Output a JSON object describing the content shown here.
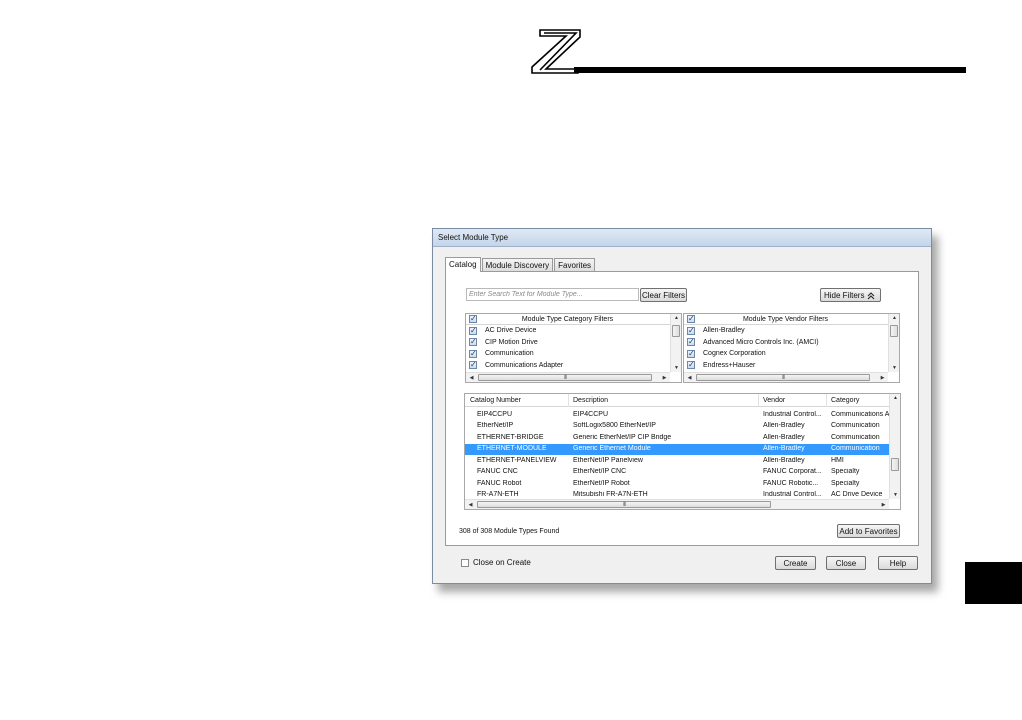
{
  "dialog": {
    "title": "Select Module Type",
    "tabs": [
      "Catalog",
      "Module Discovery",
      "Favorites"
    ],
    "search_placeholder": "Enter Search Text for Module Type...",
    "clear_filters_label": "Clear Filters",
    "hide_filters_label": "Hide Filters",
    "category_filter": {
      "header": "Module Type Category Filters",
      "items": [
        {
          "label": "AC Drive Device",
          "checked": true
        },
        {
          "label": "CIP Motion Drive",
          "checked": true
        },
        {
          "label": "Communication",
          "checked": true
        },
        {
          "label": "Communications Adapter",
          "checked": true
        }
      ]
    },
    "vendor_filter": {
      "header": "Module Type Vendor Filters",
      "items": [
        {
          "label": "Allen-Bradley",
          "checked": true
        },
        {
          "label": "Advanced Micro Controls Inc. (AMCI)",
          "checked": true
        },
        {
          "label": "Cognex Corporation",
          "checked": true
        },
        {
          "label": "Endress+Hauser",
          "checked": true
        }
      ]
    },
    "table": {
      "columns": [
        "Catalog Number",
        "Description",
        "Vendor",
        "Category"
      ],
      "rows": [
        {
          "catalog": "EIP4CCPU",
          "description": "EIP4CCPU",
          "vendor": "Industrial Control...",
          "category": "Communications A",
          "selected": false
        },
        {
          "catalog": "EtherNet/IP",
          "description": "SoftLogix5800 EtherNet/IP",
          "vendor": "Allen-Bradley",
          "category": "Communication",
          "selected": false
        },
        {
          "catalog": "ETHERNET-BRIDGE",
          "description": "Generic EtherNet/IP CIP Bridge",
          "vendor": "Allen-Bradley",
          "category": "Communication",
          "selected": false
        },
        {
          "catalog": "ETHERNET-MODULE",
          "description": "Generic Ethernet Module",
          "vendor": "Allen-Bradley",
          "category": "Communication",
          "selected": true
        },
        {
          "catalog": "ETHERNET-PANELVIEW",
          "description": "EtherNet/IP Panelview",
          "vendor": "Allen-Bradley",
          "category": "HMI",
          "selected": false
        },
        {
          "catalog": "FANUC CNC",
          "description": "EtherNet/IP CNC",
          "vendor": "FANUC Corporat...",
          "category": "Specialty",
          "selected": false
        },
        {
          "catalog": "FANUC Robot",
          "description": "EtherNet/IP Robot",
          "vendor": "FANUC Robotic...",
          "category": "Specialty",
          "selected": false
        },
        {
          "catalog": "FR-A7N-ETH",
          "description": "Mitsubishi FR-A7N-ETH",
          "vendor": "Industrial Control...",
          "category": "AC Drive Device",
          "selected": false
        }
      ]
    },
    "found_count": "308  of 308 Module Types Found",
    "add_to_favorites_label": "Add to Favorites",
    "close_on_create_label": "Close on Create",
    "close_on_create_checked": false,
    "create_label": "Create",
    "close_label": "Close",
    "help_label": "Help"
  },
  "scrollbar_grip": "III",
  "colors": {
    "selection": "#3399ff",
    "header_rule": "#000000"
  }
}
